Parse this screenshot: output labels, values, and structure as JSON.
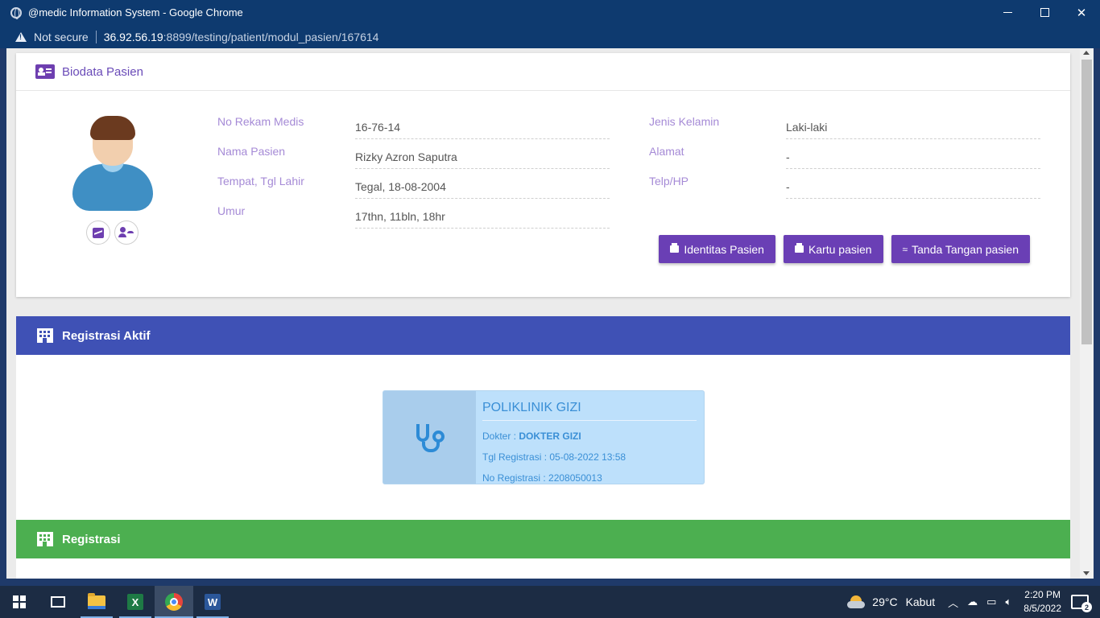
{
  "window": {
    "title": "@medic Information System - Google Chrome"
  },
  "addressbar": {
    "security": "Not secure",
    "host": "36.92.56.19",
    "path": ":8899/testing/patient/modul_pasien/167614"
  },
  "biodata": {
    "title": "Biodata Pasien",
    "left_fields": [
      {
        "label": "No Rekam Medis",
        "value": "16-76-14"
      },
      {
        "label": "Nama Pasien",
        "value": "Rizky Azron Saputra"
      },
      {
        "label": "Tempat, Tgl Lahir",
        "value": "Tegal, 18-08-2004"
      },
      {
        "label": "Umur",
        "value": "17thn, 11bln, 18hr"
      }
    ],
    "right_fields": [
      {
        "label": "Jenis Kelamin",
        "value": "Laki-laki"
      },
      {
        "label": "Alamat",
        "value": "-"
      },
      {
        "label": "Telp/HP",
        "value": "-"
      }
    ],
    "buttons": {
      "identitas": "Identitas Pasien",
      "kartu": "Kartu pasien",
      "ttd": "Tanda Tangan pasien"
    }
  },
  "registrasi_aktif": {
    "title": "Registrasi Aktif",
    "poli": {
      "name": "POLIKLINIK GIZI",
      "dokter_label": "Dokter : ",
      "dokter": "DOKTER GIZI",
      "tgl": "Tgl Registrasi : 05-08-2022 13:58",
      "no": "No Registrasi : 2208050013"
    }
  },
  "registrasi": {
    "title": "Registrasi"
  },
  "taskbar": {
    "excel_letter": "X",
    "word_letter": "W",
    "temperature": "29°C",
    "weather": "Kabut",
    "time": "2:20 PM",
    "date": "8/5/2022",
    "notifications": "2"
  },
  "colors": {
    "purple": "#6a3fb5",
    "indigo": "#3f51b5",
    "green": "#4caf50",
    "poli_blue": "#bde0fb"
  }
}
